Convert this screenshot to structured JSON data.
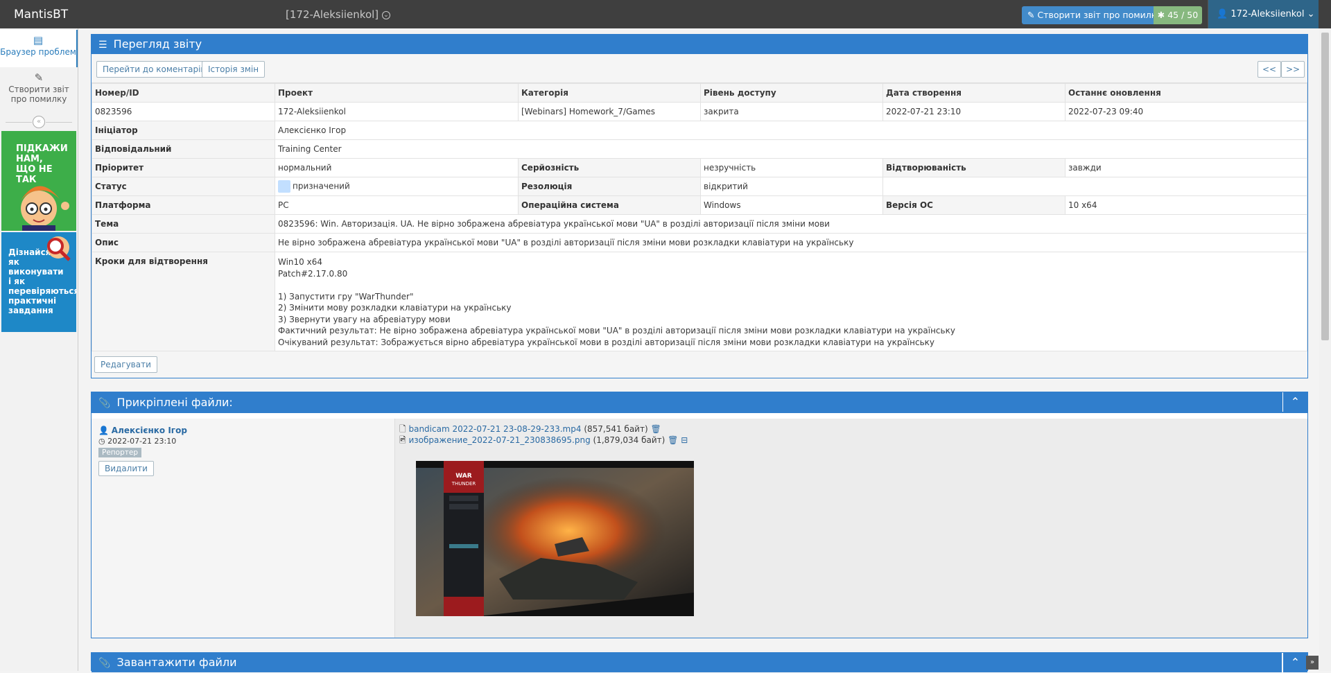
{
  "navbar": {
    "brand": "MantisBT",
    "project": "[172-Aleksiienkol]",
    "report_button": "Створити звіт про помилку",
    "issue_count": "45 / 50",
    "user": "172-Aleksiienkol"
  },
  "sidebar": {
    "items": [
      {
        "label": "Браузер проблем",
        "icon": "list-icon"
      },
      {
        "label": "Створити звіт про помилку",
        "icon": "edit-icon"
      }
    ],
    "ad1_text": "ПІДКАЖИ НАМ, ЩО НЕ ТАК",
    "ad2_text": "Дізнайся як виконувати і як перевіряються практичні завдання"
  },
  "view": {
    "title": "Перегляд звіту",
    "btn_jump_notes": "Перейти до коментарів",
    "btn_history": "Історія змін",
    "btn_prev": "<<",
    "btn_next": ">>",
    "headers": [
      "Номер/ID",
      "Проект",
      "Категорія",
      "Рівень доступу",
      "Дата створення",
      "Останнє оновлення"
    ],
    "values": [
      "0823596",
      "172-Aleksiienkol",
      "[Webinars] Homework_7/Games",
      "закрита",
      "2022-07-21 23:10",
      "2022-07-23 09:40"
    ],
    "reporter_label": "Ініціатор",
    "reporter": "Алексієнко Ігор",
    "handler_label": "Відповідальний",
    "handler": "Training Center",
    "priority_label": "Пріоритет",
    "priority": "нормальний",
    "severity_label": "Серйозність",
    "severity": "незручність",
    "repro_label": "Відтворюваність",
    "repro": "завжди",
    "status_label": "Статус",
    "status": "призначений",
    "status_color": "#c2dfff",
    "resolution_label": "Резолюція",
    "resolution": "відкритий",
    "platform_label": "Платформа",
    "platform": "PC",
    "os_label": "Операційна система",
    "os": "Windows",
    "os_ver_label": "Версія ОС",
    "os_ver": "10 x64",
    "summary_label": "Тема",
    "summary": "0823596: Win. Авторизація. UA. Не вірно зображена абревіатура української мови \"UA\" в розділі авторизації після зміни мови",
    "desc_label": "Опис",
    "desc": "Не вірно зображена абревіатура української мови \"UA\" в розділі авторизації після зміни мови розкладки клавіатури на українську",
    "steps_label": "Кроки для відтворення",
    "steps": "Win10 x64\nPatch#2.17.0.80\n\n1) Запустити гру \"WarThunder\"\n2) Змінити мову розкладки клавіатури на українську\n3) Звернути увагу на абревіатуру мови\nФактичний результат: Не вірно зображена абревіатура української мови \"UA\" в розділі авторизації після зміни мови розкладки клавіатури на українську\nОчікуваний результат: Зображується вірно абревіатура української мови в розділі авторизації після зміни мови розкладки клавіатури на українську",
    "edit_button": "Редагувати"
  },
  "attachments": {
    "title": "Прикріплені файли:",
    "author": "Алексієнко Ігор",
    "date": "2022-07-21 23:10",
    "role": "Репортер",
    "delete_button": "Видалити",
    "files": [
      {
        "name": "bandicam 2022-07-21 23-08-29-233.mp4",
        "size": "(857,541 байт)"
      },
      {
        "name": "изображение_2022-07-21_230838695.png",
        "size": "(1,879,034 байт)"
      }
    ]
  },
  "upload": {
    "title": "Завантажити файли"
  }
}
